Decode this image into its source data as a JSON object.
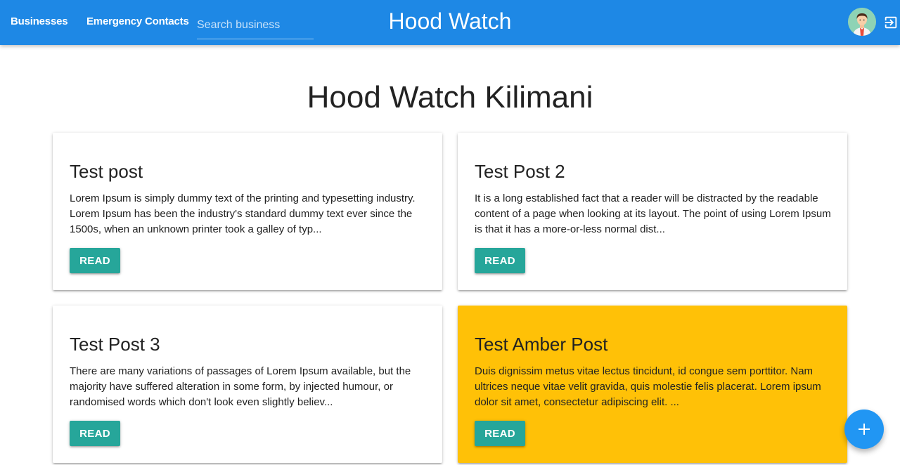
{
  "nav": {
    "businesses_label": "Businesses",
    "emergency_label": "Emergency Contacts",
    "search_placeholder": "Search business",
    "brand": "Hood Watch",
    "avatar_icon": "user-avatar",
    "logout_icon": "logout-icon"
  },
  "page": {
    "title": "Hood Watch Kilimani"
  },
  "posts": [
    {
      "title": "Test post",
      "excerpt": "Lorem Ipsum is simply dummy text of the printing and typesetting industry. Lorem Ipsum has been the industry's standard dummy text ever since the 1500s, when an unknown printer took a galley of typ...",
      "button": "READ",
      "color": "#ffffff"
    },
    {
      "title": "Test Post 2",
      "excerpt": "It is a long established fact that a reader will be distracted by the readable content of a page when looking at its layout. The point of using Lorem Ipsum is that it has a more-or-less normal dist...",
      "button": "READ",
      "color": "#ffffff"
    },
    {
      "title": "Test Post 3",
      "excerpt": "There are many variations of passages of Lorem Ipsum available, but the majority have suffered alteration in some form, by injected humour, or randomised words which don't look even slightly believ...",
      "button": "READ",
      "color": "#ffffff"
    },
    {
      "title": "Test Amber Post",
      "excerpt": "Duis dignissim metus vitae lectus tincidunt, id congue sem porttitor. Nam ultrices neque vitae velit gravida, quis molestie felis placerat. Lorem ipsum dolor sit amet, consectetur adipiscing elit. ...",
      "button": "READ",
      "color": "#ffc107"
    }
  ],
  "fab": {
    "icon": "add-icon"
  },
  "colors": {
    "navbar": "#1e88e5",
    "button": "#26a69a",
    "fab": "#2196f3",
    "amber": "#ffc107"
  }
}
